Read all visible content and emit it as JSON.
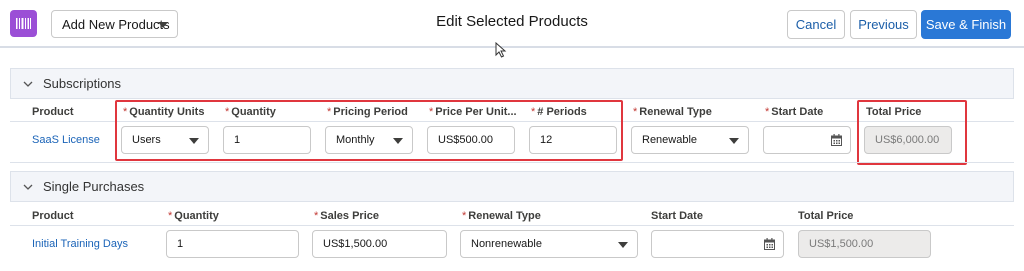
{
  "header": {
    "add_products_label": "Add New Products",
    "title": "Edit Selected Products",
    "cancel_label": "Cancel",
    "previous_label": "Previous",
    "save_finish_label": "Save & Finish"
  },
  "subscriptions": {
    "title": "Subscriptions",
    "columns": {
      "product": "Product",
      "quantity_units": "Quantity Units",
      "quantity": "Quantity",
      "pricing_period": "Pricing Period",
      "price_per_unit": "Price Per Unit...",
      "periods": "# Periods",
      "renewal_type": "Renewal Type",
      "start_date": "Start Date",
      "total_price": "Total Price"
    },
    "row": {
      "product": "SaaS License",
      "quantity_units": "Users",
      "quantity": "1",
      "pricing_period": "Monthly",
      "price_per_unit": "US$500.00",
      "periods": "12",
      "renewal_type": "Renewable",
      "start_date": "",
      "total_price": "US$6,000.00"
    }
  },
  "single_purchases": {
    "title": "Single Purchases",
    "columns": {
      "product": "Product",
      "quantity": "Quantity",
      "sales_price": "Sales Price",
      "renewal_type": "Renewal Type",
      "start_date": "Start Date",
      "total_price": "Total Price"
    },
    "row": {
      "product": "Initial Training Days",
      "quantity": "1",
      "sales_price": "US$1,500.00",
      "renewal_type": "Nonrenewable",
      "start_date": "",
      "total_price": "US$1,500.00"
    }
  },
  "colors": {
    "app_icon": "#9b4fd6",
    "brand_button": "#2a78d6",
    "link": "#1b64b8",
    "required": "#c23934",
    "highlight": "#e0363e"
  },
  "icons": [
    "barcode-icon",
    "chevron-down-icon",
    "calendar-icon",
    "cursor-icon"
  ]
}
